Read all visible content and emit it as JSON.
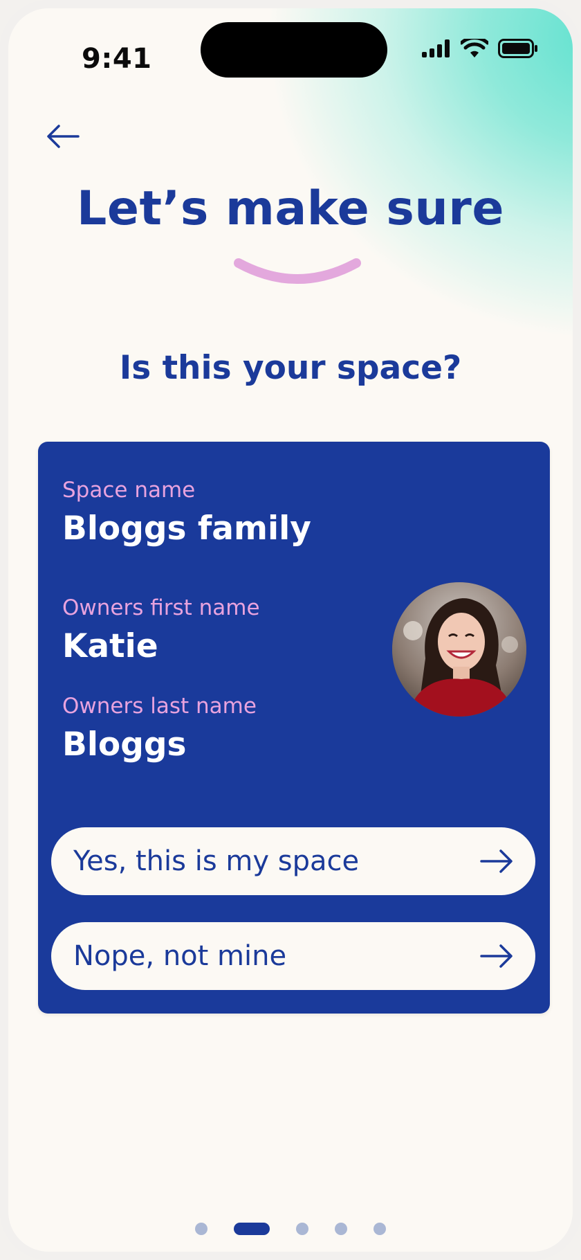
{
  "status_bar": {
    "time": "9:41"
  },
  "header": {
    "back_icon": "arrow-left-icon",
    "title": "Let’s make sure",
    "question": "Is this your space?"
  },
  "card": {
    "space_name_label": "Space name",
    "space_name_value": "Bloggs family",
    "first_name_label": "Owners first name",
    "first_name_value": "Katie",
    "last_name_label": "Owners last name",
    "last_name_value": "Bloggs",
    "avatar": "owner-photo",
    "actions": {
      "confirm_label": "Yes, this is my space",
      "deny_label": "Nope, not mine",
      "arrow_icon": "arrow-right-icon"
    }
  },
  "pager": {
    "total": 5,
    "active_index": 1
  },
  "colors": {
    "brand_blue": "#1b3a9a",
    "accent_pink": "#e8a3de",
    "background": "#fcf9f4",
    "gradient_teal": "#5fe1cf"
  }
}
